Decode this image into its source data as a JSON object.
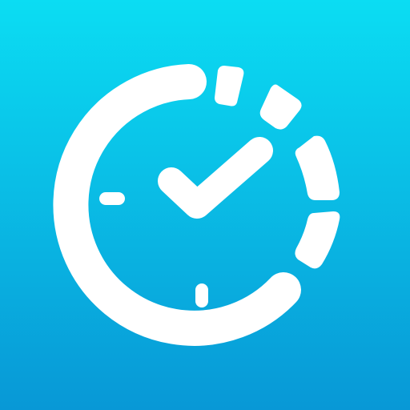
{
  "icon": {
    "name": "timer-check-icon",
    "background_gradient": {
      "top": "#0BDDF3",
      "bottom": "#0898D6"
    },
    "glyph_color": "#FFFFFF"
  }
}
